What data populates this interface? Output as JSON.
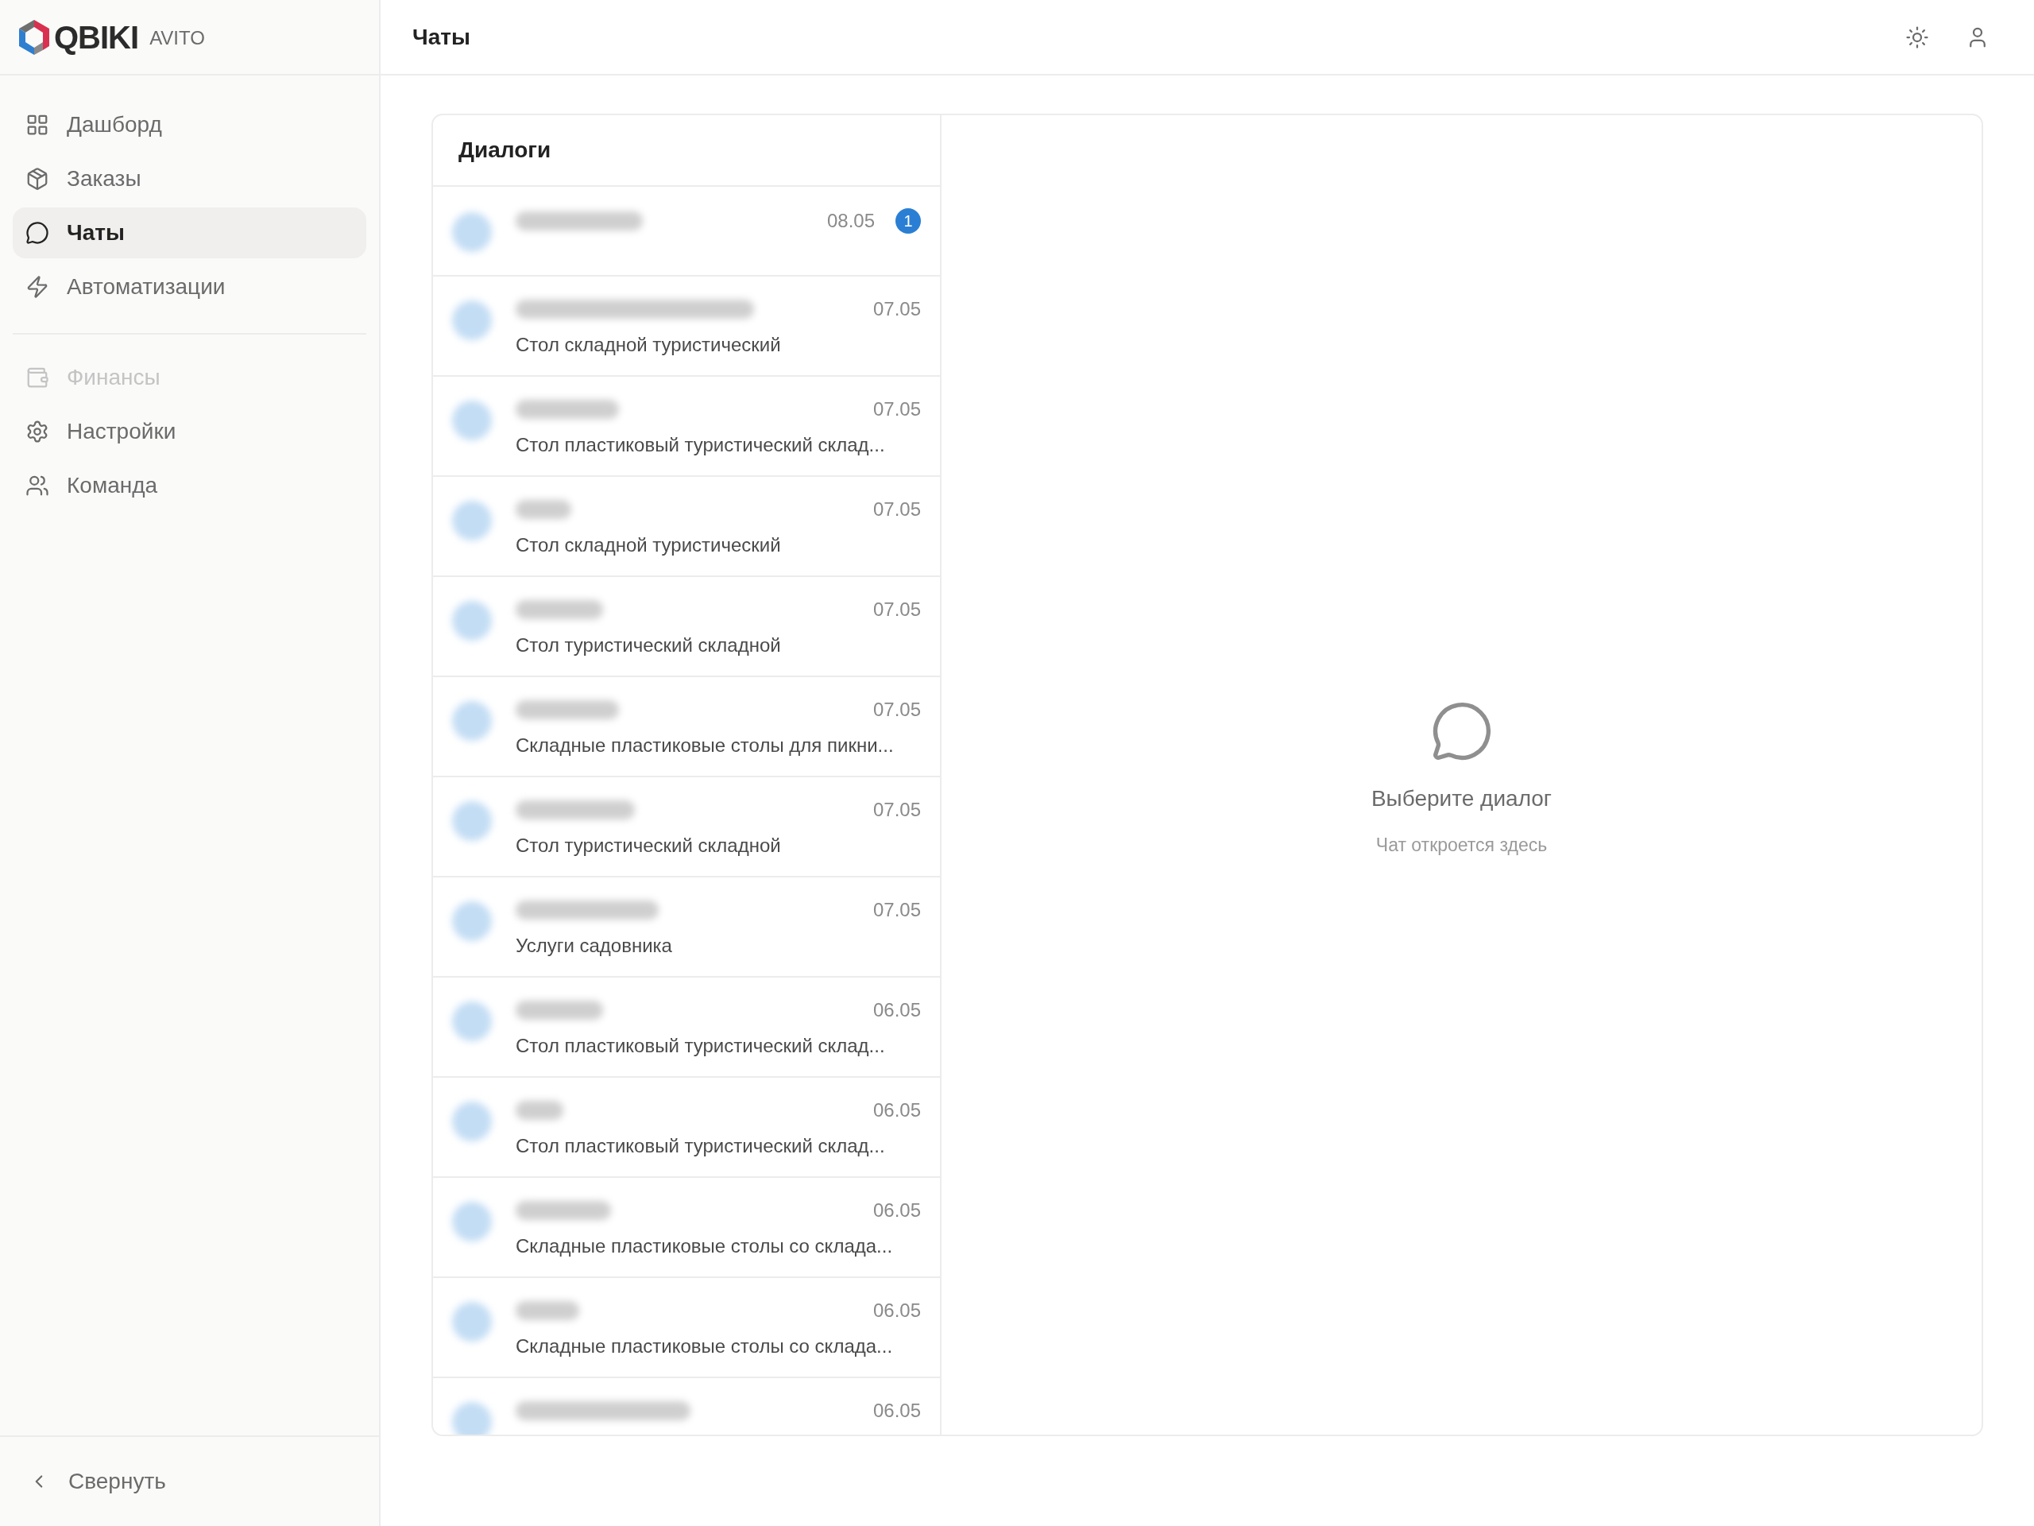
{
  "brand": {
    "name": "QBIKI",
    "product": "AVITO"
  },
  "sidebar": {
    "items": [
      {
        "label": "Дашборд",
        "selected": false,
        "disabled": false
      },
      {
        "label": "Заказы",
        "selected": false,
        "disabled": false
      },
      {
        "label": "Чаты",
        "selected": true,
        "disabled": false
      },
      {
        "label": "Автоматизации",
        "selected": false,
        "disabled": false
      }
    ],
    "secondary_items": [
      {
        "label": "Финансы",
        "selected": false,
        "disabled": true
      },
      {
        "label": "Настройки",
        "selected": false,
        "disabled": false
      },
      {
        "label": "Команда",
        "selected": false,
        "disabled": false
      }
    ],
    "collapse_button": "Свернуть"
  },
  "header": {
    "title": "Чаты"
  },
  "dialogs": {
    "title": "Диалоги",
    "items": [
      {
        "date": "08.05",
        "unread": "1"
      },
      {
        "date": "07.05",
        "preview": "Стол складной туристический"
      },
      {
        "date": "07.05",
        "preview": "Стол пластиковый туристический склад..."
      },
      {
        "date": "07.05",
        "preview": "Стол складной туристический"
      },
      {
        "date": "07.05",
        "preview": "Стол туристический складной"
      },
      {
        "date": "07.05",
        "preview": "Складные пластиковые столы для пикни..."
      },
      {
        "date": "07.05",
        "preview": "Стол туристический складной"
      },
      {
        "date": "07.05",
        "preview": "Услуги садовника"
      },
      {
        "date": "06.05",
        "preview": "Стол пластиковый туристический склад..."
      },
      {
        "date": "06.05",
        "preview": "Стол пластиковый туристический склад..."
      },
      {
        "date": "06.05",
        "preview": "Складные пластиковые столы со склада..."
      },
      {
        "date": "06.05",
        "preview": "Складные пластиковые столы со склада..."
      },
      {
        "date": "06.05"
      }
    ]
  },
  "empty_state": {
    "title": "Выберите диалог",
    "subtitle": "Чат откроется здесь"
  }
}
